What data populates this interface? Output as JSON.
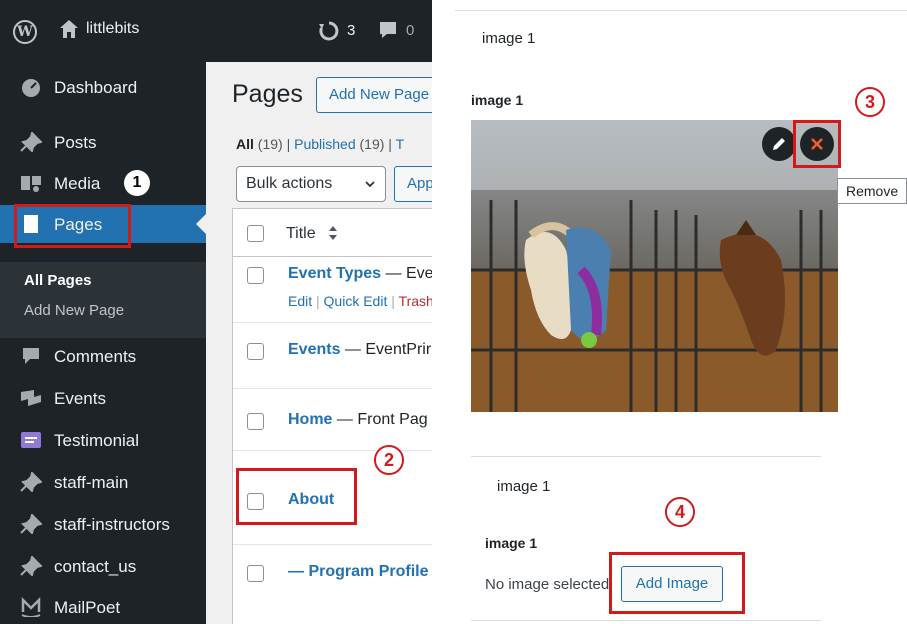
{
  "admin_bar": {
    "site_name": "littlebits",
    "updates_count": "3",
    "comments_count": "0"
  },
  "sidebar": {
    "items": [
      {
        "label": "Dashboard",
        "icon": "dashboard-icon"
      },
      {
        "label": "Posts",
        "icon": "pin-icon"
      },
      {
        "label": "Media",
        "icon": "media-icon"
      },
      {
        "label": "Pages",
        "icon": "page-icon"
      },
      {
        "label": "Comments",
        "icon": "comment-icon"
      },
      {
        "label": "Events",
        "icon": "events-icon"
      },
      {
        "label": "Testimonial",
        "icon": "testimonial-icon"
      },
      {
        "label": "staff-main",
        "icon": "pin-icon"
      },
      {
        "label": "staff-instructors",
        "icon": "pin-icon"
      },
      {
        "label": "contact_us",
        "icon": "pin-icon"
      },
      {
        "label": "MailPoet",
        "icon": "mailpoet-icon"
      }
    ],
    "submenu": [
      "All Pages",
      "Add New Page"
    ]
  },
  "pages_screen": {
    "title": "Pages",
    "add_new_label": "Add New Page",
    "filters": {
      "all": "All",
      "all_count": "(19)",
      "sep": "|",
      "published": "Published",
      "published_count": "(19)",
      "sep2": "|",
      "trash_initial": "T"
    },
    "bulk_actions": "Bulk actions",
    "apply_label": "Apply",
    "column_title": "Title",
    "rows": [
      {
        "title": "Event Types",
        "suffix": "— Eve",
        "actions": [
          "Edit",
          "Quick Edit",
          "Trash"
        ]
      },
      {
        "title": "Events",
        "suffix": "— EventPrir"
      },
      {
        "title": "Home",
        "suffix": "— Front Pag"
      },
      {
        "title": "About",
        "suffix": ""
      },
      {
        "title": "",
        "suffix": "— Program Profile"
      }
    ],
    "row_action_sep": "|"
  },
  "acf_panel_1": {
    "group_label": "image 1",
    "field_label": "image 1",
    "edit_icon": "pencil-icon",
    "remove_icon": "close-icon",
    "tooltip": "Remove"
  },
  "acf_panel_2": {
    "group_label": "image 1",
    "field_label": "image 1",
    "no_image_text": "No image selected",
    "add_image_label": "Add Image"
  },
  "annotations": {
    "step1": "1",
    "step2": "2",
    "step3": "3",
    "step4": "4",
    "highlight_color": "#d21a1a"
  },
  "colors": {
    "admin_dark": "#1d2327",
    "wp_blue": "#2271b1",
    "trash_red": "#b32d2e"
  }
}
